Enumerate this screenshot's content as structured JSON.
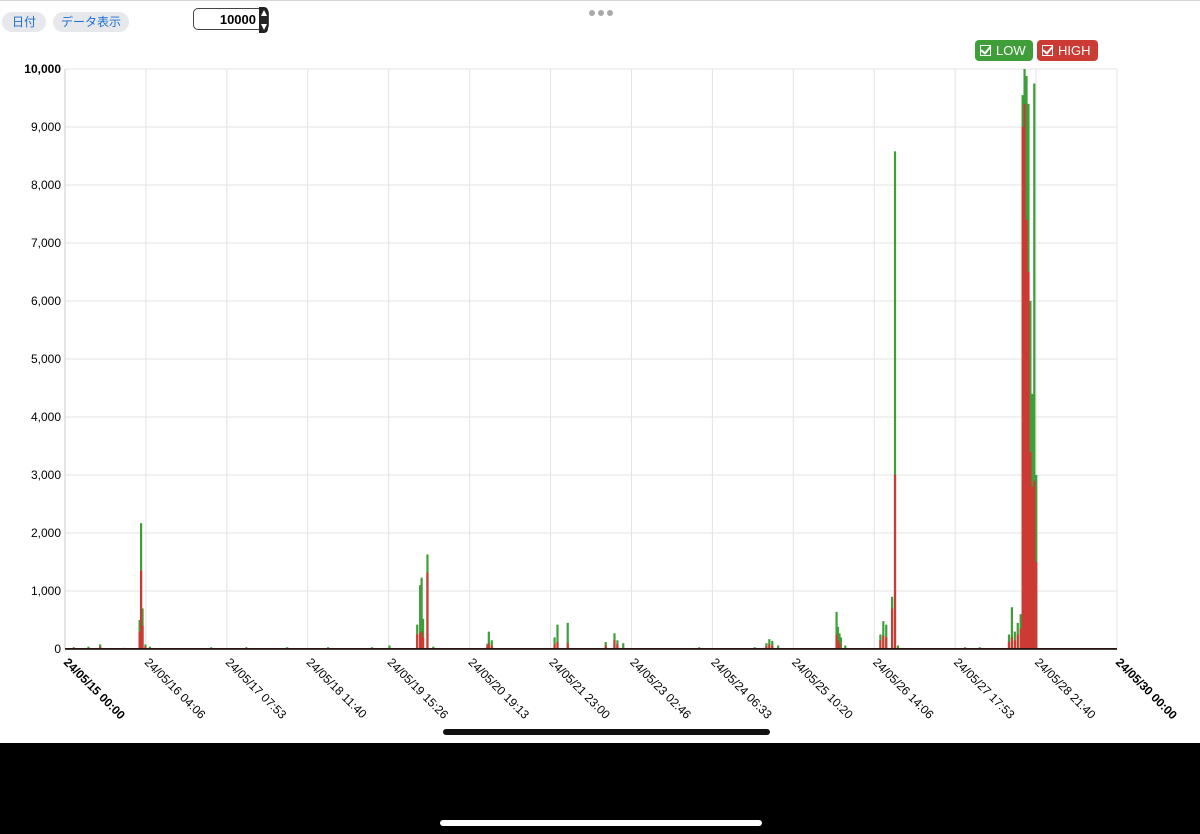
{
  "toolbar": {
    "date_button": "日付",
    "data_button": "データ表示",
    "max_value_input": "10000"
  },
  "legend": [
    {
      "label": "LOW",
      "color": "#3f9e3a"
    },
    {
      "label": "HIGH",
      "color": "#cc3b33"
    }
  ],
  "chart_data": {
    "type": "bar",
    "stacked_overlay": true,
    "ylim": [
      0,
      10000
    ],
    "yticks": [
      "0",
      "1,000",
      "2,000",
      "3,000",
      "4,000",
      "5,000",
      "6,000",
      "7,000",
      "8,000",
      "9,000",
      "10,000"
    ],
    "xticks": [
      {
        "label": "24/05/15 00:00",
        "bold": true
      },
      {
        "label": "24/05/16 04:06",
        "bold": false
      },
      {
        "label": "24/05/17 07:53",
        "bold": false
      },
      {
        "label": "24/05/18 11:40",
        "bold": false
      },
      {
        "label": "24/05/19 15:26",
        "bold": false
      },
      {
        "label": "24/05/20 19:13",
        "bold": false
      },
      {
        "label": "24/05/21 23:00",
        "bold": false
      },
      {
        "label": "24/05/23 02:46",
        "bold": false
      },
      {
        "label": "24/05/24 06:33",
        "bold": false
      },
      {
        "label": "24/05/25 10:20",
        "bold": false
      },
      {
        "label": "24/05/26 14:06",
        "bold": false
      },
      {
        "label": "24/05/27 17:53",
        "bold": false
      },
      {
        "label": "24/05/28 21:40",
        "bold": false
      },
      {
        "label": "24/05/30 00:00",
        "bold": true
      }
    ],
    "x_start": "2024-05-15 00:00",
    "x_end": "2024-05-30 00:00",
    "grid": true,
    "legend_position": "top-right",
    "series": [
      {
        "name": "LOW",
        "color": "#3f9e3a",
        "points": [
          [
            "2024-05-15 03:00",
            30
          ],
          [
            "2024-05-15 08:00",
            40
          ],
          [
            "2024-05-15 12:00",
            80
          ],
          [
            "2024-05-15 20:00",
            20
          ],
          [
            "2024-05-16 01:30",
            500
          ],
          [
            "2024-05-16 02:00",
            2170
          ],
          [
            "2024-05-16 02:30",
            700
          ],
          [
            "2024-05-16 03:30",
            80
          ],
          [
            "2024-05-16 05:00",
            40
          ],
          [
            "2024-05-17 02:00",
            30
          ],
          [
            "2024-05-17 14:00",
            30
          ],
          [
            "2024-05-18 04:00",
            30
          ],
          [
            "2024-05-18 18:00",
            30
          ],
          [
            "2024-05-19 09:00",
            30
          ],
          [
            "2024-05-19 15:00",
            60
          ],
          [
            "2024-05-20 00:30",
            420
          ],
          [
            "2024-05-20 01:30",
            1100
          ],
          [
            "2024-05-20 02:00",
            1230
          ],
          [
            "2024-05-20 02:30",
            520
          ],
          [
            "2024-05-20 04:00",
            1630
          ],
          [
            "2024-05-20 06:00",
            40
          ],
          [
            "2024-05-21 00:30",
            90
          ],
          [
            "2024-05-21 01:00",
            300
          ],
          [
            "2024-05-21 02:00",
            150
          ],
          [
            "2024-05-21 23:30",
            200
          ],
          [
            "2024-05-22 00:30",
            420
          ],
          [
            "2024-05-22 04:00",
            450
          ],
          [
            "2024-05-22 17:00",
            120
          ],
          [
            "2024-05-22 20:00",
            270
          ],
          [
            "2024-05-22 21:00",
            150
          ],
          [
            "2024-05-22 23:00",
            100
          ],
          [
            "2024-05-24 01:00",
            30
          ],
          [
            "2024-05-24 20:00",
            30
          ],
          [
            "2024-05-25 00:00",
            100
          ],
          [
            "2024-05-25 01:00",
            170
          ],
          [
            "2024-05-25 02:00",
            140
          ],
          [
            "2024-05-25 04:00",
            60
          ],
          [
            "2024-05-26 00:00",
            640
          ],
          [
            "2024-05-26 00:30",
            380
          ],
          [
            "2024-05-26 01:00",
            270
          ],
          [
            "2024-05-26 01:30",
            200
          ],
          [
            "2024-05-26 03:00",
            60
          ],
          [
            "2024-05-26 15:00",
            250
          ],
          [
            "2024-05-26 16:00",
            480
          ],
          [
            "2024-05-26 17:00",
            420
          ],
          [
            "2024-05-26 19:00",
            900
          ],
          [
            "2024-05-26 20:00",
            8580
          ],
          [
            "2024-05-26 21:00",
            60
          ],
          [
            "2024-05-27 20:00",
            30
          ],
          [
            "2024-05-28 01:00",
            30
          ],
          [
            "2024-05-28 11:00",
            250
          ],
          [
            "2024-05-28 12:00",
            720
          ],
          [
            "2024-05-28 13:00",
            300
          ],
          [
            "2024-05-28 14:00",
            450
          ],
          [
            "2024-05-28 15:00",
            600
          ],
          [
            "2024-05-28 15:40",
            9550
          ],
          [
            "2024-05-28 16:20",
            10000
          ],
          [
            "2024-05-28 17:00",
            9880
          ],
          [
            "2024-05-28 17:40",
            9400
          ],
          [
            "2024-05-28 18:20",
            6000
          ],
          [
            "2024-05-28 19:00",
            4400
          ],
          [
            "2024-05-28 19:40",
            9750
          ],
          [
            "2024-05-28 20:20",
            3000
          ]
        ]
      },
      {
        "name": "HIGH",
        "color": "#cc3b33",
        "points": [
          [
            "2024-05-15 03:00",
            20
          ],
          [
            "2024-05-15 12:00",
            40
          ],
          [
            "2024-05-16 01:30",
            300
          ],
          [
            "2024-05-16 02:00",
            1350
          ],
          [
            "2024-05-16 02:30",
            400
          ],
          [
            "2024-05-16 03:30",
            40
          ],
          [
            "2024-05-20 00:30",
            250
          ],
          [
            "2024-05-20 01:30",
            280
          ],
          [
            "2024-05-20 02:00",
            300
          ],
          [
            "2024-05-20 02:30",
            200
          ],
          [
            "2024-05-20 04:00",
            1320
          ],
          [
            "2024-05-21 00:30",
            50
          ],
          [
            "2024-05-21 01:00",
            100
          ],
          [
            "2024-05-21 02:00",
            60
          ],
          [
            "2024-05-21 23:30",
            80
          ],
          [
            "2024-05-22 00:30",
            120
          ],
          [
            "2024-05-22 04:00",
            100
          ],
          [
            "2024-05-22 17:00",
            60
          ],
          [
            "2024-05-22 20:00",
            150
          ],
          [
            "2024-05-22 21:00",
            80
          ],
          [
            "2024-05-25 00:00",
            50
          ],
          [
            "2024-05-25 01:00",
            80
          ],
          [
            "2024-05-25 02:00",
            60
          ],
          [
            "2024-05-26 00:00",
            250
          ],
          [
            "2024-05-26 00:30",
            150
          ],
          [
            "2024-05-26 01:00",
            100
          ],
          [
            "2024-05-26 15:00",
            150
          ],
          [
            "2024-05-26 16:00",
            230
          ],
          [
            "2024-05-26 17:00",
            200
          ],
          [
            "2024-05-26 19:00",
            700
          ],
          [
            "2024-05-26 20:00",
            3000
          ],
          [
            "2024-05-28 11:00",
            120
          ],
          [
            "2024-05-28 12:00",
            200
          ],
          [
            "2024-05-28 13:00",
            150
          ],
          [
            "2024-05-28 14:00",
            250
          ],
          [
            "2024-05-28 15:00",
            350
          ],
          [
            "2024-05-28 15:40",
            9000
          ],
          [
            "2024-05-28 16:20",
            9400
          ],
          [
            "2024-05-28 17:00",
            7400
          ],
          [
            "2024-05-28 17:40",
            6500
          ],
          [
            "2024-05-28 18:20",
            3400
          ],
          [
            "2024-05-28 19:00",
            2800
          ],
          [
            "2024-05-28 19:40",
            2900
          ],
          [
            "2024-05-28 20:20",
            1500
          ]
        ]
      }
    ]
  }
}
